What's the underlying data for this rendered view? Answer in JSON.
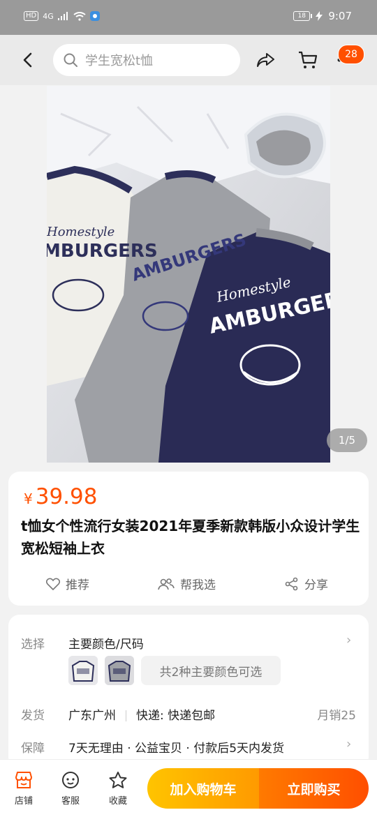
{
  "status_bar": {
    "network": "4G",
    "battery": "18",
    "time": "9:07"
  },
  "nav": {
    "search_placeholder": "学生宽松t恤",
    "cart_badge": "28"
  },
  "gallery": {
    "counter": "1/5"
  },
  "product": {
    "currency": "¥",
    "price": "39.98",
    "title": "t恤女个性流行女装2021年夏季新款韩版小众设计学生宽松短袖上衣",
    "actions": {
      "recommend": "推荐",
      "help_pick": "帮我选",
      "share": "分享"
    }
  },
  "details": {
    "select_label": "选择",
    "select_value": "主要颜色/尺码",
    "colors_pill": "共2种主要颜色可选",
    "ship_label": "发货",
    "ship_origin": "广东广州",
    "ship_method": "快递: 快递包邮",
    "monthly_sales": "月销25",
    "guarantee_label": "保障",
    "guarantee_value": "7天无理由 · 公益宝贝 · 付款后5天内发货"
  },
  "bottom_bar": {
    "shop": "店铺",
    "service": "客服",
    "favorite": "收藏",
    "add_to_cart": "加入购物车",
    "buy_now": "立即购买"
  },
  "colors": {
    "accent": "#ff5000",
    "cart_btn": "#ffb000",
    "buy_btn": "#ff5a00"
  }
}
